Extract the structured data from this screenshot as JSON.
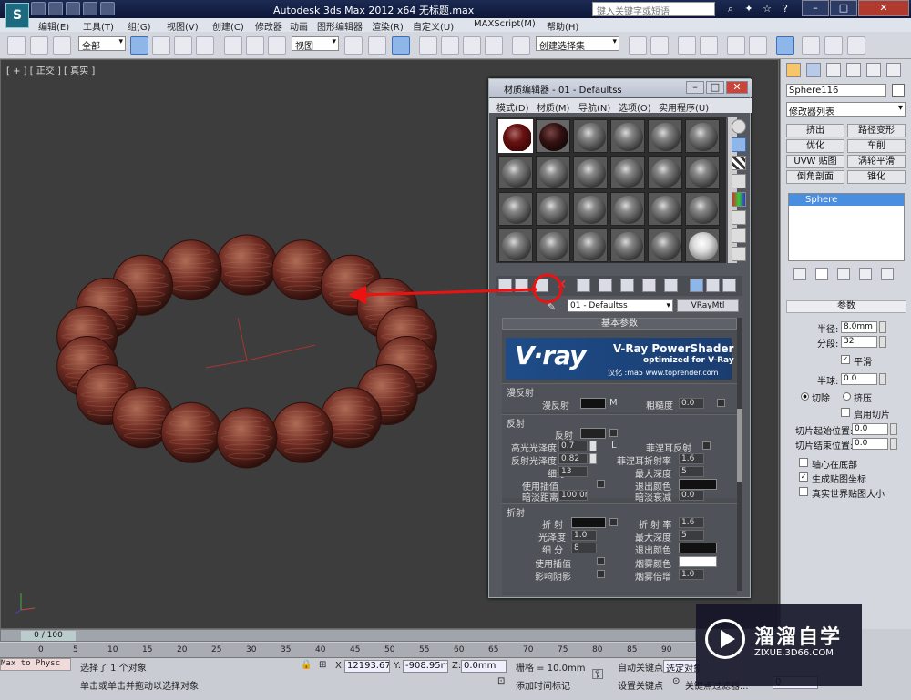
{
  "app": {
    "title": "Autodesk 3ds Max  2012 x64    无标题.max",
    "search_placeholder": "键入关键字或短语"
  },
  "menubar": [
    "编辑(E)",
    "工具(T)",
    "组(G)",
    "视图(V)",
    "创建(C)",
    "修改器",
    "动画",
    "图形编辑器",
    "渲染(R)",
    "自定义(U)",
    "MAXScript(M)",
    "帮助(H)"
  ],
  "toolbar": {
    "selection_filter": "全部",
    "ref_coord": "视图",
    "named_selection": "创建选择集"
  },
  "viewport": {
    "label": "[ + ] [ 正交 ] [ 真实 ]"
  },
  "material_editor": {
    "title": "材质编辑器 - 01 - Defaultss",
    "menu": [
      "模式(D)",
      "材质(M)",
      "导航(N)",
      "选项(O)",
      "实用程序(U)"
    ],
    "material_name": "01 - Defaultss",
    "material_type": "VRayMtl",
    "rollout_title": "基本参数",
    "vray_banner": {
      "logo": "V·ray",
      "product": "V-Ray PowerShader",
      "tagline": "optimized for V-Ray",
      "credit": "汉化 :ma5 www.toprender.com"
    },
    "diffuse": {
      "section": "漫反射",
      "label": "漫反射",
      "map_btn": "M",
      "roughness_label": "粗糙度",
      "roughness": "0.0"
    },
    "reflection": {
      "section": "反射",
      "label": "反射",
      "hilight_gloss_label": "高光光泽度",
      "hilight_gloss": "0.7",
      "lock_label": "L",
      "fresnel_label": "菲涅耳反射",
      "refl_gloss_label": "反射光泽度",
      "refl_gloss": "0.82",
      "fresnel_ior_label": "菲涅耳折射率",
      "fresnel_ior": "1.6",
      "subdivs_label": "细分",
      "subdivs": "13",
      "max_depth_label": "最大深度",
      "max_depth": "5",
      "use_interp_label": "使用插值",
      "exit_color_label": "退出颜色",
      "dim_dist_label": "暗淡距离",
      "dim_dist": "100.0m",
      "dim_falloff_label": "暗淡衰减",
      "dim_falloff": "0.0"
    },
    "refraction": {
      "section": "折射",
      "label": "折 射",
      "ior_label": "折 射 率",
      "ior": "1.6",
      "gloss_label": "光泽度",
      "gloss": "1.0",
      "max_depth_label": "最大深度",
      "max_depth": "5",
      "subdivs_label": "细 分",
      "subdivs": "8",
      "exit_color_label": "退出颜色",
      "use_interp_label": "使用插值",
      "fog_color_label": "烟雾颜色",
      "affect_shadows_label": "影响阴影",
      "fog_mult_label": "烟雾倍增",
      "fog_mult": "1.0"
    }
  },
  "command_panel": {
    "object_name": "Sphere116",
    "modifier_list": "修改器列表",
    "modifier_buttons": [
      "挤出",
      "路径变形",
      "优化",
      "车削",
      "UVW 贴图",
      "涡轮平滑",
      "倒角剖面",
      "锥化"
    ],
    "stack_item": "Sphere",
    "params_title": "参数",
    "radius_label": "半径:",
    "radius": "8.0mm",
    "segments_label": "分段:",
    "segments": "32",
    "smooth_label": "平滑",
    "hemisphere_label": "半球:",
    "hemisphere": "0.0",
    "chop_label": "切除",
    "squash_label": "挤压",
    "slice_on_label": "启用切片",
    "slice_from_label": "切片起始位置:",
    "slice_from": "0.0",
    "slice_to_label": "切片结束位置:",
    "slice_to": "0.0",
    "base_pivot_label": "轴心在底部",
    "gen_map_label": "生成贴图坐标",
    "real_world_label": "真实世界贴图大小"
  },
  "timeline": {
    "frame": "0 / 100",
    "ticks": [
      "0",
      "5",
      "10",
      "15",
      "20",
      "25",
      "30",
      "35",
      "40",
      "45",
      "50",
      "55",
      "60",
      "65",
      "70",
      "75",
      "80",
      "85",
      "90"
    ]
  },
  "status": {
    "script_listener": "Max to Physc",
    "selected": "选择了 1 个对象",
    "prompt": "单击或单击并拖动以选择对象",
    "x_label": "X:",
    "x": "12193.673",
    "y_label": "Y:",
    "y": "-908.95mm",
    "z_label": "Z:",
    "z": "0.0mm",
    "grid": "栅格 = 10.0mm",
    "add_time_tag": "添加时间标记",
    "auto_key": "自动关键点",
    "set_key": "设置关键点",
    "selected_set": "选定对象",
    "key_filters": "关键点过滤器...",
    "frame_field": "0"
  },
  "watermark": {
    "name": "溜溜自学",
    "url": "ZIXUE.3D66.COM"
  },
  "bead_colors": {
    "base": "#6e2b22",
    "light": "#b06b55",
    "dark": "#2e100c"
  }
}
